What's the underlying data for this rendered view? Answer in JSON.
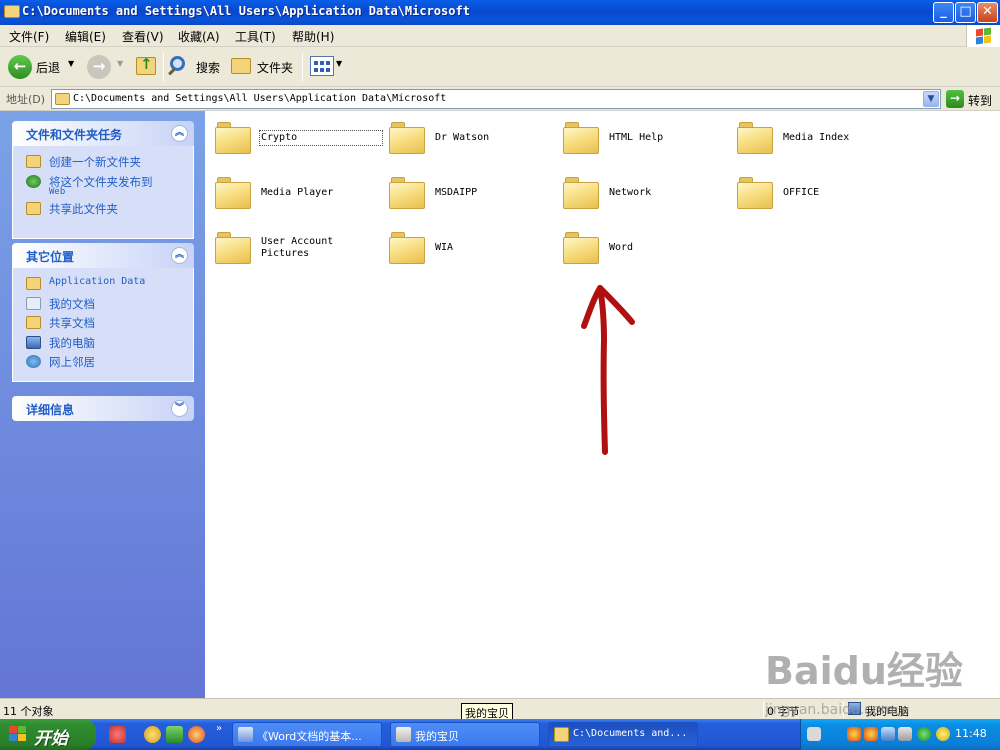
{
  "window": {
    "title": "C:\\Documents and Settings\\All Users\\Application Data\\Microsoft"
  },
  "menu": [
    "文件(F)",
    "编辑(E)",
    "查看(V)",
    "收藏(A)",
    "工具(T)",
    "帮助(H)"
  ],
  "toolbar": {
    "back_label": "后退",
    "search_label": "搜索",
    "folders_label": "文件夹"
  },
  "address": {
    "label": "地址(D)",
    "value": "C:\\Documents and Settings\\All Users\\Application Data\\Microsoft",
    "go_label": "转到"
  },
  "taskpane": {
    "tasks_title": "文件和文件夹任务",
    "tasks": [
      {
        "label": "创建一个新文件夹",
        "icon": "new-folder-icon"
      },
      {
        "label": "将这个文件夹发布到",
        "label2": "Web",
        "icon": "publish-web-icon"
      },
      {
        "label": "共享此文件夹",
        "icon": "share-folder-icon"
      }
    ],
    "places_title": "其它位置",
    "places": [
      {
        "label": "Application Data",
        "icon": "folder-icon"
      },
      {
        "label": "我的文档",
        "icon": "my-documents-icon"
      },
      {
        "label": "共享文档",
        "icon": "shared-documents-icon"
      },
      {
        "label": "我的电脑",
        "icon": "my-computer-icon"
      },
      {
        "label": "网上邻居",
        "icon": "network-places-icon"
      }
    ],
    "details_title": "详细信息"
  },
  "folders": [
    {
      "name": "Crypto"
    },
    {
      "name": "Dr Watson"
    },
    {
      "name": "HTML Help"
    },
    {
      "name": "Media Index"
    },
    {
      "name": "Media Player"
    },
    {
      "name": "MSDAIPP"
    },
    {
      "name": "Network"
    },
    {
      "name": "OFFICE"
    },
    {
      "name": "User Account\nPictures"
    },
    {
      "name": "WIA"
    },
    {
      "name": "Word"
    }
  ],
  "status": {
    "count": "11 个对象",
    "size": "0 字节",
    "location": "我的电脑",
    "tooltip": "我的宝贝"
  },
  "taskbar": {
    "start_label": "开始",
    "buttons": [
      {
        "label": "《Word文档的基本..."
      },
      {
        "label": "我的宝贝"
      },
      {
        "label": "C:\\Documents and..."
      }
    ],
    "clock": "11:48"
  },
  "watermark": {
    "line1": "Baidu经验",
    "line2": "jingyan.baidu.com"
  },
  "colors": {
    "title_blue": "#0a53d9",
    "link_blue": "#215dc6",
    "annotation_red": "#b01010"
  }
}
